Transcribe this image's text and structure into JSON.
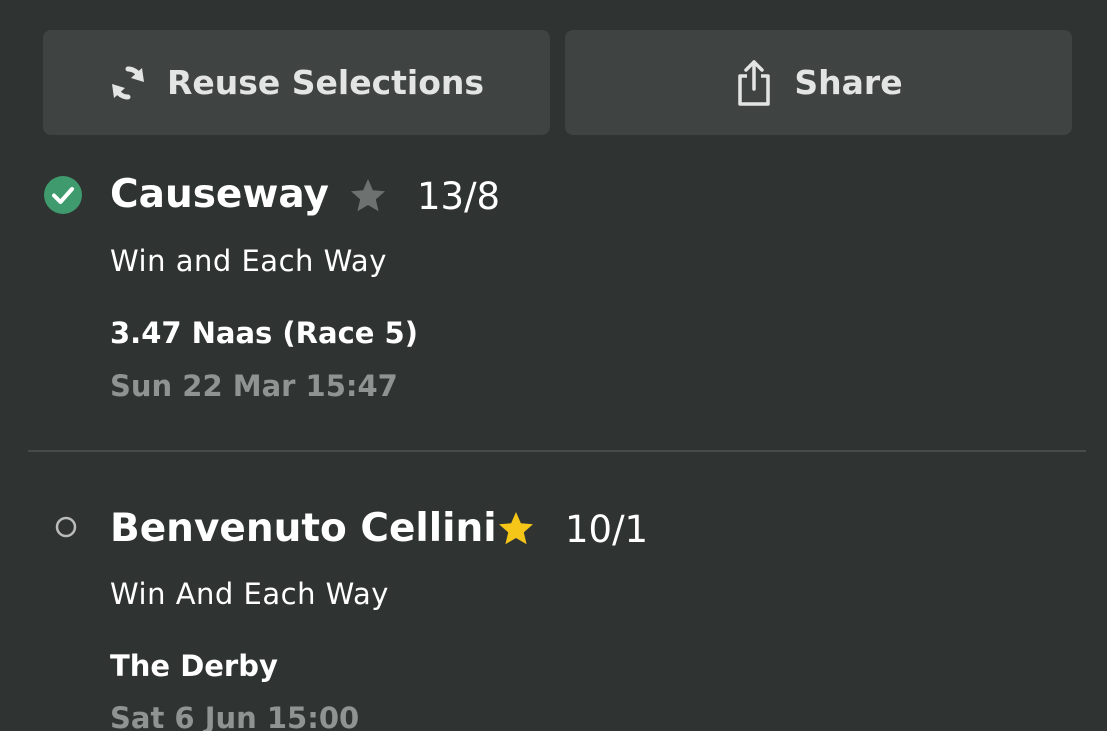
{
  "actions": {
    "reuse_label": "Reuse Selections",
    "share_label": "Share"
  },
  "selections": [
    {
      "status": "won",
      "name": "Causeway",
      "favourite": false,
      "odds": "13/8",
      "market": "Win and Each Way",
      "event": "3.47 Naas (Race 5)",
      "time": "Sun 22 Mar 15:47"
    },
    {
      "status": "pending",
      "name": "Benvenuto Cellini",
      "favourite": true,
      "odds": "10/1",
      "market": "Win And Each Way",
      "event": "The Derby",
      "time": "Sat 6 Jun 15:00"
    }
  ],
  "colors": {
    "background": "#2f3432",
    "button_bg": "#3f4442",
    "check_green": "#3f9a6e",
    "star_active": "#f5c518",
    "star_inactive": "#6d716f",
    "muted_text": "#8f9391"
  }
}
